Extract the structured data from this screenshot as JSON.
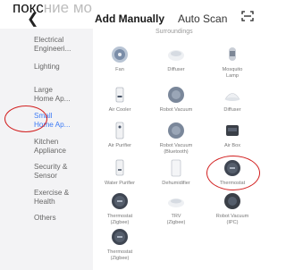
{
  "caption": {
    "text": "покс",
    "faded": "ние мо"
  },
  "header": {
    "back_icon": "back-chevron-icon",
    "tab_add_manually": "Add Manually",
    "tab_auto_scan": "Auto Scan",
    "scan_icon": "scan-frame-icon"
  },
  "sidebar": {
    "items": [
      {
        "label": "Electrical\nEngineeri..."
      },
      {
        "label": "Lighting"
      },
      {
        "label": "Large\nHome Ap..."
      },
      {
        "label": "Small\nHome Ap..."
      },
      {
        "label": "Kitchen\nAppliance"
      },
      {
        "label": "Security &\nSensor"
      },
      {
        "label": "Exercise &\nHealth"
      },
      {
        "label": "Others"
      }
    ],
    "active_index": 3
  },
  "main": {
    "section_label": "Surroundings",
    "devices": [
      {
        "label": "Fan",
        "icon": "fan-icon"
      },
      {
        "label": "Diffuser",
        "icon": "diffuser-icon"
      },
      {
        "label": "Mosquito\nLamp",
        "icon": "mosquito-lamp-icon"
      },
      {
        "label": "Air Cooler",
        "icon": "air-cooler-icon"
      },
      {
        "label": "Robot Vacuum",
        "icon": "robot-vacuum-icon"
      },
      {
        "label": "Diffuser",
        "icon": "diffuser-icon"
      },
      {
        "label": "Air Purifier",
        "icon": "air-purifier-icon"
      },
      {
        "label": "Robot Vacuum\n(Bluetooth)",
        "icon": "robot-vacuum-icon"
      },
      {
        "label": "Air Box",
        "icon": "air-box-icon"
      },
      {
        "label": "Water Purifier",
        "icon": "water-purifier-icon"
      },
      {
        "label": "Dehumidifier",
        "icon": "dehumidifier-icon"
      },
      {
        "label": "Thermostat",
        "icon": "thermostat-icon"
      },
      {
        "label": "Thermostat\n(Zigbee)",
        "icon": "thermostat-icon"
      },
      {
        "label": "TRV\n(Zigbee)",
        "icon": "trv-icon"
      },
      {
        "label": "Robot Vacuum\n(IPC)",
        "icon": "robot-vacuum-icon"
      },
      {
        "label": "Thermostat\n(Zigbee)",
        "icon": "thermostat-icon"
      }
    ]
  },
  "colors": {
    "accent": "#3d7bf5",
    "annotation": "#d21f1f",
    "sidebar_bg": "#f3f3f5"
  }
}
